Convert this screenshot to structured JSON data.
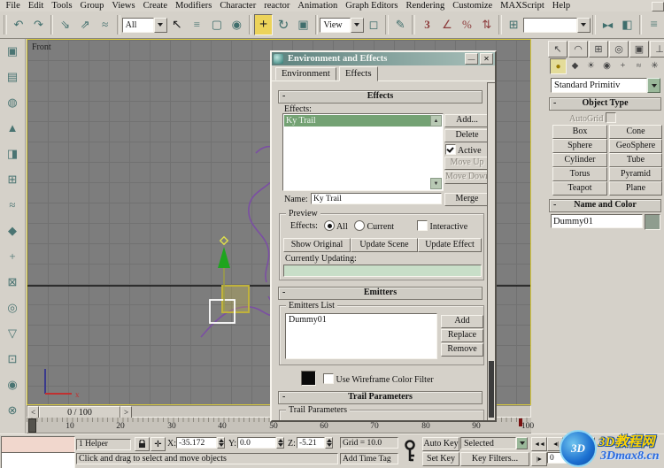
{
  "menu": [
    "File",
    "Edit",
    "Tools",
    "Group",
    "Views",
    "Create",
    "Modifiers",
    "Character",
    "reactor",
    "Animation",
    "Graph Editors",
    "Rendering",
    "Customize",
    "MAXScript",
    "Help"
  ],
  "toolbar": {
    "all_value": "All",
    "view_value": "View",
    "named_sel_value": "",
    "glyphs": {
      "undo": "↶",
      "redo": "↷",
      "select_link": "⇘",
      "unlink": "⇗",
      "bind": "≈",
      "select": "↖",
      "by_name": "≡",
      "region": "▢",
      "crossing": "◉",
      "move": "+",
      "rotate": "↻",
      "scale": "▣",
      "pivot": "◻",
      "manipulate": "✎",
      "snap3": "3",
      "angle": "∠",
      "percent": "%",
      "spinner": "⇅",
      "named_sets": "⊞",
      "mirror": "▶◀",
      "align": "◧",
      "layers": "≡"
    }
  },
  "reactor_icons": [
    "▣",
    "▤",
    "◍",
    "▲",
    "◨",
    "⊞",
    "≈",
    "◆",
    "+",
    "⊠",
    "◎",
    "▽",
    "⊡",
    "◉",
    "⊗"
  ],
  "viewport": {
    "label": "Front",
    "axis_x": "x"
  },
  "dialog": {
    "title": "Environment and Effects",
    "buttons": {
      "minimize": "—",
      "close": "✕"
    },
    "tab_environment": "Environment",
    "tab_effects": "Effects",
    "effects": {
      "header": "Effects",
      "list_label": "Effects:",
      "selected_item": "Ky Trail",
      "add": "Add...",
      "delete": "Delete",
      "active_label": "Active",
      "move_up": "Move Up",
      "move_down": "Move Down",
      "name_label": "Name:",
      "name_value": "Ky Trail",
      "merge": "Merge"
    },
    "preview": {
      "title": "Preview",
      "effects_label": "Effects:",
      "all": "All",
      "current": "Current",
      "interactive": "Interactive",
      "show_original": "Show Original",
      "update_scene": "Update Scene",
      "update_effect": "Update Effect",
      "currently_updating": "Currently Updating:"
    },
    "emitters": {
      "header": "Emitters",
      "group": "Emitters List",
      "item": "Dummy01",
      "add": "Add",
      "replace": "Replace",
      "remove": "Remove",
      "wireframe": "Use Wireframe Color Filter"
    },
    "trail": {
      "header": "Trail Parameters",
      "group": "Trail Parameters"
    }
  },
  "command_panel": {
    "tab_glyphs": [
      "↖",
      "◠",
      "⊞",
      "◎",
      "▣",
      "⊥"
    ],
    "cat_glyphs": [
      "●",
      "◆",
      "☀",
      "◉",
      "+",
      "≈",
      "✳"
    ],
    "dropdown_value": "Standard Primitiv",
    "object_type": {
      "header": "Object Type",
      "autogrid": "AutoGrid",
      "buttons": [
        "Box",
        "Cone",
        "Sphere",
        "GeoSphere",
        "Cylinder",
        "Tube",
        "Torus",
        "Pyramid",
        "Teapot",
        "Plane"
      ]
    },
    "name_color": {
      "header": "Name and Color",
      "value": "Dummy01"
    }
  },
  "timeline": {
    "value": "0 / 100",
    "prev": "<",
    "next": ">",
    "ticks": [
      "10",
      "20",
      "30",
      "40",
      "50",
      "60",
      "70",
      "80",
      "90",
      "100"
    ]
  },
  "status": {
    "selection": "1 Helper",
    "x_label": "X:",
    "x": "-35.172",
    "y_label": "Y:",
    "y": "0.0",
    "z_label": "Z:",
    "z": "-5.21",
    "grid": "Grid = 10.0",
    "prompt": "Click and drag to select and move objects",
    "add_time_tag": "Add Time Tag",
    "auto_key": "Auto Key",
    "set_key": "Set Key",
    "selected_dd": "Selected",
    "key_filters": "Key Filters...",
    "frame": "0",
    "playback": [
      "◄◄",
      "◄|",
      "►",
      "►|",
      "|►"
    ]
  },
  "watermark": {
    "logo": "3D",
    "line1": "3D教程网",
    "line2": "3Dmax8.cn"
  }
}
